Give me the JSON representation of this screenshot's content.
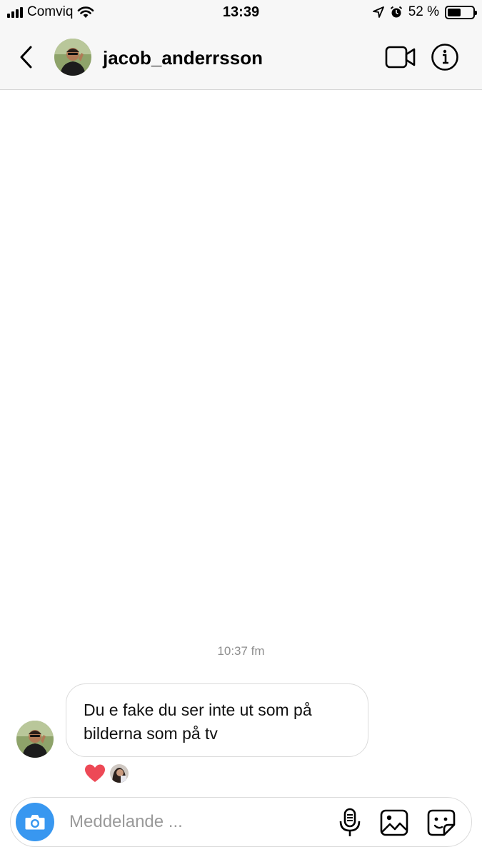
{
  "status_bar": {
    "carrier": "Comviq",
    "time": "13:39",
    "battery_text": "52 %",
    "battery_level": 0.52,
    "icons": [
      "signal-icon",
      "wifi-icon",
      "location-icon",
      "alarm-icon",
      "battery-icon"
    ]
  },
  "header": {
    "username": "jacob_anderrsson",
    "icons": [
      "back-chevron-icon",
      "video-call-icon",
      "info-icon"
    ]
  },
  "chat": {
    "timestamp": "10:37 fm",
    "messages": [
      {
        "text": "Du e fake du ser inte ut som på bilderna som på tv",
        "reactions": [
          "heart"
        ]
      }
    ]
  },
  "composer": {
    "placeholder": "Meddelande ...",
    "value": "",
    "icons": [
      "camera-icon",
      "microphone-icon",
      "gallery-icon",
      "sticker-icon"
    ]
  },
  "colors": {
    "accent": "#3897f0",
    "heart": "#ed4956",
    "timestamp": "#8e8e8e",
    "border": "#dbdbdb"
  }
}
